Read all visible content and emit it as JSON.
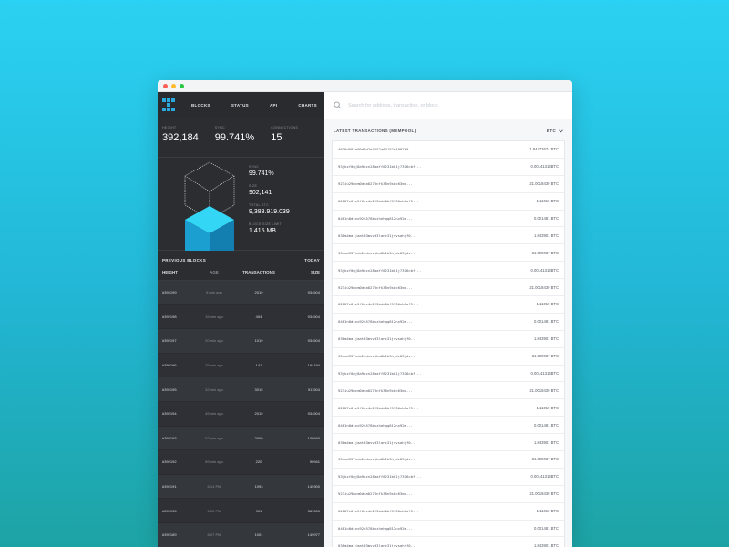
{
  "window": {
    "dots": [
      "#ff5f57",
      "#febc2e",
      "#28c840"
    ]
  },
  "nav": {
    "items": [
      "BLOCKS",
      "STATUS",
      "API",
      "CHARTS"
    ]
  },
  "stats": [
    {
      "label": "HEIGHT",
      "value": "392,184"
    },
    {
      "label": "SYNC",
      "value": "99.741%"
    },
    {
      "label": "CONNECTIONS",
      "value": "15"
    }
  ],
  "viz": {
    "info": [
      {
        "label": "SYNC",
        "value": "99.741%"
      },
      {
        "label": "SIZE",
        "value": "902,141"
      },
      {
        "label": "TOTAL BTC",
        "value": "9,383.919.039"
      },
      {
        "label": "BLOCK SIZE LIMIT",
        "value": "1.415 MB"
      }
    ]
  },
  "previous_blocks": {
    "title": "PREVIOUS BLOCKS",
    "filter": "TODAY",
    "columns": [
      "HEIGHT",
      "AGE",
      "TRANSACTIONS",
      "SIZE"
    ],
    "rows": [
      {
        "height": "#392199",
        "age": "8 min ago",
        "tx": "2019",
        "size": "934504"
      },
      {
        "height": "#392198",
        "age": "15 min ago",
        "tx": "404",
        "size": "934504"
      },
      {
        "height": "#392197",
        "age": "20 min ago",
        "tx": "1019",
        "size": "934504"
      },
      {
        "height": "#392196",
        "age": "25 min ago",
        "tx": "141",
        "size": "194194"
      },
      {
        "height": "#392195",
        "age": "32 min ago",
        "tx": "3015",
        "size": "911504"
      },
      {
        "height": "#392194",
        "age": "45 min ago",
        "tx": "2019",
        "size": "934504"
      },
      {
        "height": "#392193",
        "age": "52 min ago",
        "tx": "2009",
        "size": "100940"
      },
      {
        "height": "#392192",
        "age": "59 min ago",
        "tx": "220",
        "size": "90941"
      },
      {
        "height": "#392191",
        "age": "6:14 PM",
        "tx": "1093",
        "size": "149300"
      },
      {
        "height": "#392195",
        "age": "6:00 PM",
        "tx": "901",
        "size": "381500"
      },
      {
        "height": "#392189",
        "age": "6:07 PM",
        "tx": "1001",
        "size": "149977"
      }
    ]
  },
  "search": {
    "placeholder": "Search for address, transaction, or block"
  },
  "transactions": {
    "title": "LATEST TRANSACTIONS (MEMPOOL)",
    "currency": "BTC",
    "rows": [
      {
        "hash": "f636d58fa09d8d7d4152a64152e4997b0...",
        "amount": "1.84472674 BTC"
      },
      {
        "hash": "93jkxf0gj8a9kcn28aaff8231bk1j7316cbf...",
        "amount": "0.00141313BTC"
      },
      {
        "hash": "923iu29mcm0dna0275nfk38n9sbc63mc...",
        "amount": "21.0018439 BTC"
      },
      {
        "hash": "02887e01e5f6cc4e225bdd0bf5130eb7af5...",
        "amount": "1.11019 BTC"
      },
      {
        "hash": "0481n0dsnx92h578bxzhehqq812nx92m...",
        "amount": "0.001481 BTC"
      },
      {
        "hash": "038m4ma1jaat93mvv93lanc31jsvsahjf0...",
        "amount": "1.843901 BTC"
      },
      {
        "hash": "93smd937nzb2ndnxzjka8b1b9hjdz83jds...",
        "amount": "31.000037 BTC"
      },
      {
        "hash": "93jkxf0gj8a9kcn28aaff8231bk1j7316cbf...",
        "amount": "0.00141313BTC"
      },
      {
        "hash": "923iu29mcm0dna0275nfk38n9sbc63mc...",
        "amount": "21.0018439 BTC"
      },
      {
        "hash": "02887e01e5f6cc4e225bdd0bf5130eb7af5...",
        "amount": "1.11019 BTC"
      },
      {
        "hash": "0481n0dsnx92h578bxzhehqq812nx92m...",
        "amount": "0.001481 BTC"
      },
      {
        "hash": "038m4ma1jaat93mvv93lanc31jsvsahjf0...",
        "amount": "1.843901 BTC"
      },
      {
        "hash": "93smd937nzb2ndnxzjka8b1b9hjdz83jds...",
        "amount": "31.000037 BTC"
      },
      {
        "hash": "93jkxf0gj8a9kcn28aaff8231bk1j7316cbf...",
        "amount": "0.00141313BTC"
      },
      {
        "hash": "923iu29mcm0dna0275nfk38n9sbc63mc...",
        "amount": "21.0018439 BTC"
      },
      {
        "hash": "02887e01e5f6cc4e225bdd0bf5130eb7af5...",
        "amount": "1.11019 BTC"
      },
      {
        "hash": "0481n0dsnx92h578bxzhehqq812nx92m...",
        "amount": "0.001481 BTC"
      },
      {
        "hash": "038m4ma1jaat93mvv93lanc31jsvsahjf0...",
        "amount": "1.843901 BTC"
      },
      {
        "hash": "93smd937nzb2ndnxzjka8b1b9hjdz83jds...",
        "amount": "31.000037 BTC"
      },
      {
        "hash": "93jkxf0gj8a9kcn28aaff8231bk1j7316cbf...",
        "amount": "0.00141313BTC"
      },
      {
        "hash": "923iu29mcm0dna0275nfk38n9sbc63mc...",
        "amount": "21.0018439 BTC"
      },
      {
        "hash": "02887e01e5f6cc4e225bdd0bf5130eb7af5...",
        "amount": "1.11019 BTC"
      },
      {
        "hash": "0481n0dsnx92h578bxzhehqq812nx92m...",
        "amount": "0.001481 BTC"
      },
      {
        "hash": "038m4ma1jaat93mvv93lanc31jsvsahjf0...",
        "amount": "1.843901 BTC"
      }
    ]
  }
}
